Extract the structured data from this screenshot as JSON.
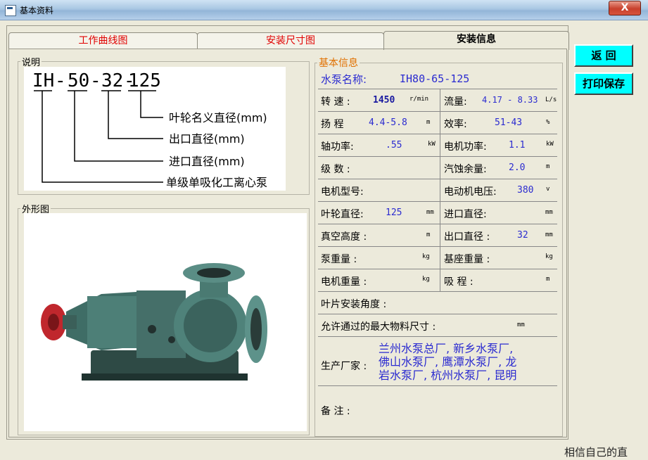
{
  "window": {
    "title": "基本资料",
    "close_label": "X"
  },
  "tabs": [
    {
      "label": "工作曲线图"
    },
    {
      "label": "安装尺寸图"
    },
    {
      "label": "安装信息"
    }
  ],
  "description": {
    "group_label": "说明",
    "model_parts": [
      "IH",
      "-",
      "50",
      "-",
      "32",
      "-",
      "125"
    ],
    "annotations": [
      "叶轮名义直径(mm)",
      "出口直径(mm)",
      "进口直径(mm)",
      "单级单吸化工离心泵"
    ]
  },
  "appearance": {
    "group_label": "外形图"
  },
  "info": {
    "group_label": "基本信息",
    "pump_name_label": "水泵名称:",
    "pump_name_value": "IH80-65-125",
    "rows": [
      {
        "l_label": "转 速 :",
        "l_value": "1450",
        "l_unit": "r/min",
        "r_label": "流量:",
        "r_value": "4.17 - 8.33",
        "r_unit": "L/s"
      },
      {
        "l_label": "扬 程",
        "l_value": "4.4-5.8",
        "l_unit": "m",
        "r_label": "效率:",
        "r_value": "51-43",
        "r_unit": "%"
      },
      {
        "l_label": "轴功率:",
        "l_value": ".55",
        "l_unit": "kW",
        "r_label": "电机功率:",
        "r_value": "1.1",
        "r_unit": "kW"
      },
      {
        "l_label": "级 数 :",
        "l_value": "",
        "l_unit": "",
        "r_label": "汽蚀余量:",
        "r_value": "2.0",
        "r_unit": "m"
      },
      {
        "l_label": "电机型号:",
        "l_value": "",
        "l_unit": "",
        "r_label": "电动机电压:",
        "r_value": "380",
        "r_unit": "v"
      },
      {
        "l_label": "叶轮直径:",
        "l_value": "125",
        "l_unit": "mm",
        "r_label": "进口直径:",
        "r_value": "",
        "r_unit": "mm"
      },
      {
        "l_label": "真空高度 :",
        "l_value": "",
        "l_unit": "m",
        "r_label": "出口直径 :",
        "r_value": "32",
        "r_unit": "mm"
      },
      {
        "l_label": "泵重量 :",
        "l_value": "",
        "l_unit": "kg",
        "r_label": "基座重量 :",
        "r_value": "",
        "r_unit": "kg"
      },
      {
        "l_label": "电机重量 :",
        "l_value": "",
        "l_unit": "kg",
        "r_label": "吸 程 :",
        "r_value": "",
        "r_unit": "m"
      }
    ],
    "blade_angle_label": "叶片安装角度 :",
    "max_particle_label": "允许通过的最大物料尺寸 :",
    "max_particle_unit": "mm",
    "manufacturer_label": "生产厂家 :",
    "manufacturer_lines": [
      "兰州水泵总厂, 新乡水泵厂,",
      "佛山水泵厂, 鹰潭水泵厂, 龙",
      "岩水泵厂, 杭州水泵厂, 昆明"
    ],
    "remarks_label": "备 注 :"
  },
  "buttons": {
    "back": "返 回",
    "print_save": "打印保存"
  },
  "footer_text": "相信自己的直"
}
